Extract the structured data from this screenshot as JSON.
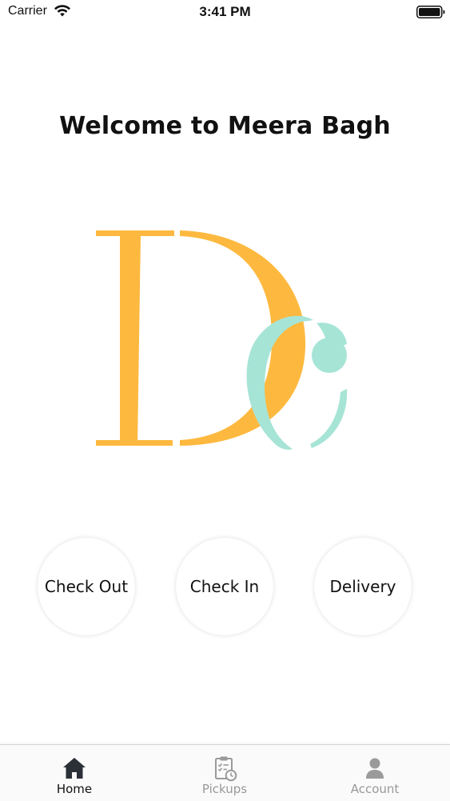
{
  "status_bar": {
    "carrier": "Carrier",
    "time": "3:41 PM",
    "wifi_icon": "wifi-icon",
    "battery_icon": "battery-icon"
  },
  "main": {
    "title": "Welcome to Meera Bagh",
    "logo": {
      "icon": "dc-monogram-logo",
      "letters": "Dc",
      "colors": {
        "d": "#FDB93F",
        "c": "#A6E4D6"
      }
    },
    "actions": [
      {
        "label": "Check Out"
      },
      {
        "label": "Check In"
      },
      {
        "label": "Delivery"
      }
    ]
  },
  "tab_bar": {
    "tabs": [
      {
        "label": "Home",
        "icon": "home-icon",
        "active": true
      },
      {
        "label": "Pickups",
        "icon": "clipboard-clock-icon",
        "active": false
      },
      {
        "label": "Account",
        "icon": "person-icon",
        "active": false
      }
    ],
    "active_color": "#111111",
    "inactive_color": "#999999"
  }
}
